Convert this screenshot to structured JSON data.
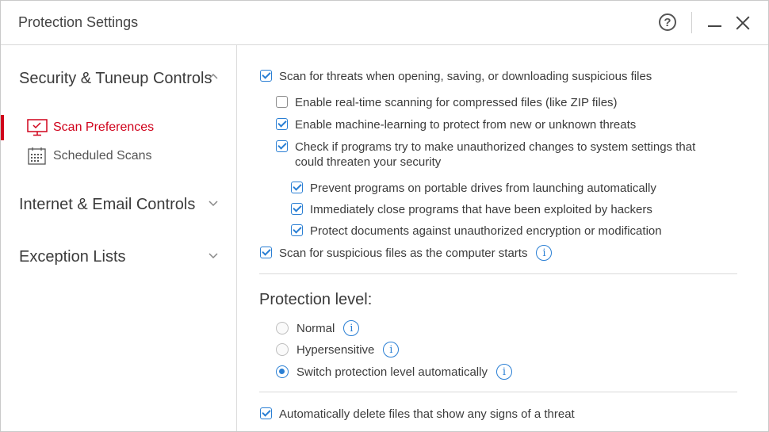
{
  "window": {
    "title": "Protection Settings",
    "help_glyph": "?"
  },
  "sidebar": {
    "sections": [
      {
        "label": "Security & Tuneup Controls",
        "expanded": true
      },
      {
        "label": "Internet & Email Controls",
        "expanded": false
      },
      {
        "label": "Exception Lists",
        "expanded": false
      }
    ],
    "items": [
      {
        "label": "Scan Preferences",
        "icon": "monitor-scan-icon",
        "active": true
      },
      {
        "label": "Scheduled Scans",
        "icon": "calendar-icon",
        "active": false
      }
    ]
  },
  "main": {
    "scan_on_access": {
      "label": "Scan for threats when opening, saving, or downloading suspicious files",
      "checked": true
    },
    "compressed": {
      "label": "Enable real-time scanning for compressed files (like ZIP files)",
      "checked": false
    },
    "ml": {
      "label": "Enable machine-learning to protect from new or unknown threats",
      "checked": true
    },
    "unauthorized": {
      "label": "Check if programs try to make unauthorized changes to system settings that could threaten your security",
      "checked": true
    },
    "portable": {
      "label": "Prevent programs on portable drives from launching automatically",
      "checked": true
    },
    "exploited": {
      "label": "Immediately close programs that have been exploited by hackers",
      "checked": true
    },
    "encryption": {
      "label": "Protect documents against unauthorized encryption or modification",
      "checked": true
    },
    "startup": {
      "label": "Scan for suspicious files as the computer starts",
      "checked": true
    },
    "protection_level": {
      "heading": "Protection level:",
      "options": [
        {
          "label": "Normal",
          "selected": false
        },
        {
          "label": "Hypersensitive",
          "selected": false
        },
        {
          "label": "Switch protection level automatically",
          "selected": true
        }
      ]
    },
    "auto_delete": {
      "label": "Automatically delete files that show any signs of a threat",
      "checked": true
    },
    "info_glyph": "i"
  },
  "colors": {
    "accent_blue": "#2a7fd4",
    "active_red": "#d0021b"
  }
}
